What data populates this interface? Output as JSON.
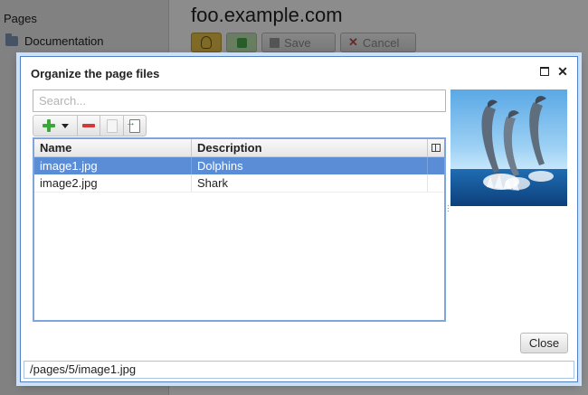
{
  "background": {
    "sidebar": {
      "pages_label": "Pages",
      "documentation_label": "Documentation"
    },
    "main": {
      "title": "foo.example.com",
      "toolbar": {
        "save_label": "Save",
        "cancel_label": "Cancel"
      }
    }
  },
  "dialog": {
    "title": "Organize the page files",
    "search": {
      "placeholder": "Search...",
      "value": ""
    },
    "grid": {
      "columns": [
        "Name",
        "Description"
      ],
      "rows": [
        {
          "name": "image1.jpg",
          "description": "Dolphins",
          "selected": true
        },
        {
          "name": "image2.jpg",
          "description": "Shark",
          "selected": false
        }
      ]
    },
    "close_label": "Close",
    "status_path": "/pages/5/image1.jpg"
  },
  "colors": {
    "selection": "#5b8dd6",
    "dialog_border": "#4f7fc4",
    "add_green": "#39a839",
    "remove_red": "#d23a3a"
  }
}
